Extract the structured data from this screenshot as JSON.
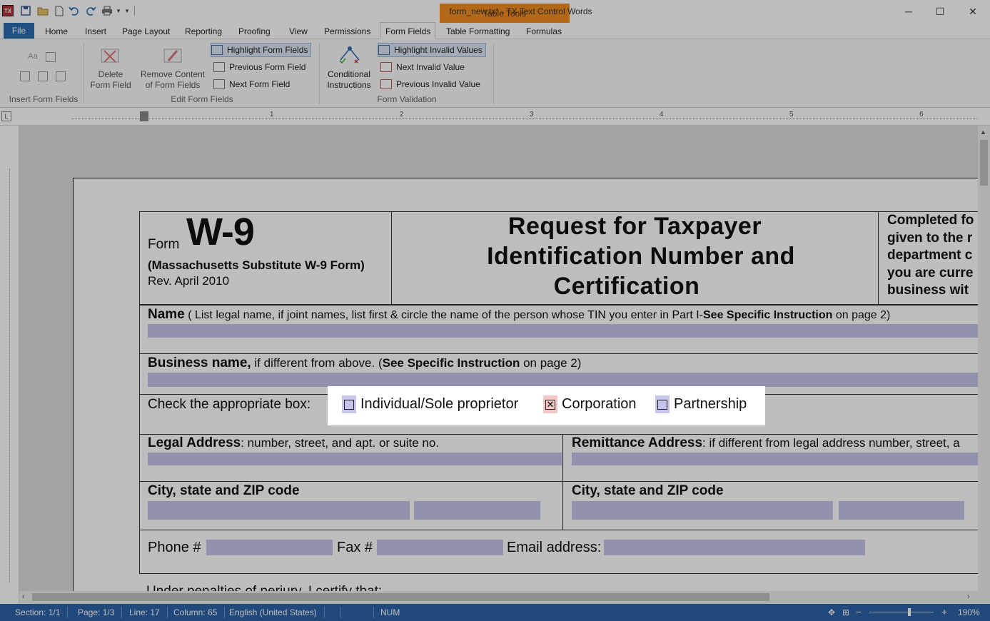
{
  "window": {
    "title": "form_new.tx* - TX Text Control Words",
    "context_tab_group": "Table Tools"
  },
  "tabs": {
    "file": "File",
    "home": "Home",
    "insert": "Insert",
    "page_layout": "Page Layout",
    "reporting": "Reporting",
    "proofing": "Proofing",
    "view": "View",
    "permissions": "Permissions",
    "form_fields": "Form Fields",
    "table_formatting": "Table Formatting",
    "formulas": "Formulas"
  },
  "ribbon": {
    "insert_group_label": "Insert Form Fields",
    "delete_form_field": [
      "Delete",
      "Form Field"
    ],
    "remove_content": [
      "Remove Content",
      "of Form Fields"
    ],
    "highlight_form_fields": "Highlight Form Fields",
    "previous_form_field": "Previous Form Field",
    "next_form_field": "Next Form Field",
    "edit_group_label": "Edit Form Fields",
    "conditional_instructions": [
      "Conditional",
      "Instructions"
    ],
    "highlight_invalid_values": "Highlight Invalid Values",
    "next_invalid_value": "Next Invalid Value",
    "previous_invalid_value": "Previous Invalid Value",
    "validation_group_label": "Form Validation"
  },
  "ruler": {
    "marks": [
      "1",
      "2",
      "3",
      "4",
      "5",
      "6"
    ]
  },
  "document": {
    "form_word": "Form",
    "form_number": "W-9",
    "subtitle": "(Massachusetts Substitute W-9 Form)",
    "rev": "Rev. April 2010",
    "title_line1": "Request for Taxpayer",
    "title_line2": "Identification Number and",
    "title_line3": "Certification",
    "side_note": [
      "Completed fo",
      "given to the r",
      "department c",
      "you are curre",
      "business wit"
    ],
    "name_label": "Name",
    "name_hint_pre": "( List legal name, if joint names, list first & circle the name of the person whose TIN you enter in Part I-",
    "name_hint_bold": "See Specific Instruction",
    "name_hint_post": "on page 2)",
    "business_label": "Business name,",
    "business_hint_pre": "if different from above. (",
    "business_hint_bold": "See Specific Instruction",
    "business_hint_post": "on page 2)",
    "check_box_label": "Check the appropriate box:",
    "options": [
      {
        "label": "Individual/Sole proprietor",
        "checked": false
      },
      {
        "label": "Corporation",
        "checked": true
      },
      {
        "label": "Partnership",
        "checked": false
      }
    ],
    "legal_address_label": "Legal Address",
    "legal_address_hint": ": number, street, and apt. or suite no.",
    "remittance_label": "Remittance Address",
    "remittance_hint": ": if different from legal address number, street, a",
    "city_label_left": "City, state and ZIP code",
    "city_label_right": "City, state and ZIP code",
    "phone_label": "Phone #",
    "fax_label": "Fax #",
    "email_label": "Email address:",
    "penalties": "Under penalties of perjury, I certify that:"
  },
  "status": {
    "section": "Section: 1/1",
    "page": "Page: 1/3",
    "line": "Line: 17",
    "column": "Column: 65",
    "language": "English (United States)",
    "num": "NUM",
    "zoom": "190%"
  },
  "colors": {
    "accent": "#2b6cb0",
    "form_field": "#c5c5ec",
    "checked_field": "#f4c6c6",
    "context_tab": "#f18d1e"
  }
}
